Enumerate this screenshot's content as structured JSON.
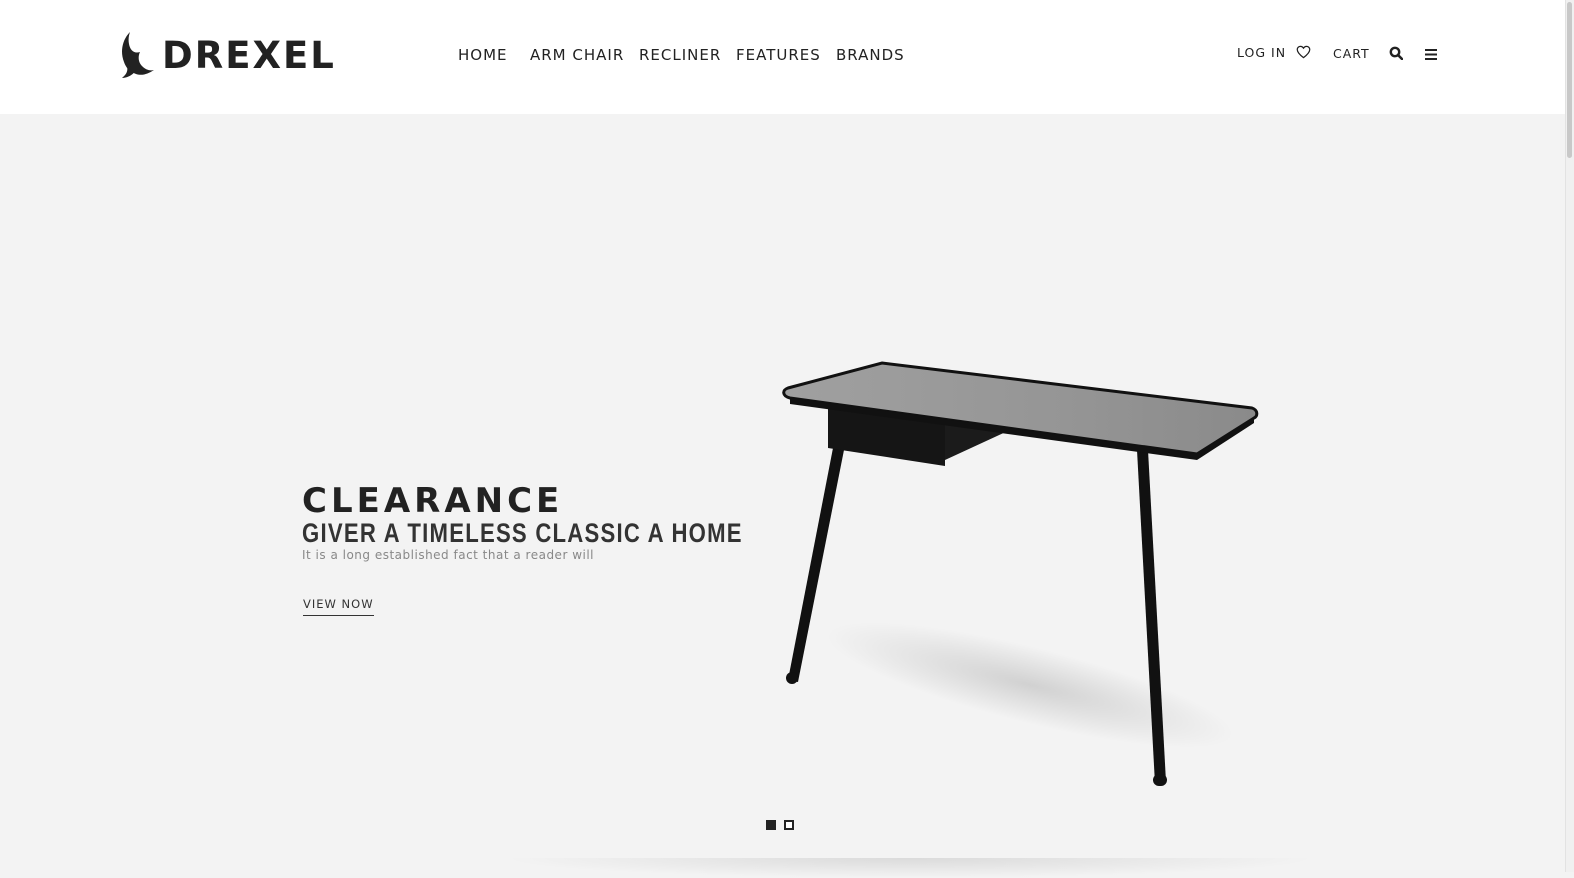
{
  "brand": {
    "name": "DREXEL",
    "logo_icon": "bird-logo-icon"
  },
  "nav": {
    "items": [
      {
        "label": "HOME"
      },
      {
        "label": "ARM CHAIR"
      },
      {
        "label": "RECLINER"
      },
      {
        "label": "FEATURES"
      },
      {
        "label": "BRANDS"
      }
    ]
  },
  "header_utils": {
    "login_label": "LOG IN",
    "wishlist_icon": "heart-icon",
    "cart_label": "CART",
    "search_icon": "search-icon",
    "menu_icon": "menu-icon"
  },
  "hero": {
    "title": "CLEARANCE",
    "subtitle": "GIVER A TIMELESS CLASSIC A HOME",
    "description": "It is a long established fact that a reader will",
    "cta_label": "VIEW NOW",
    "image": "desk-product-image"
  },
  "slider": {
    "total_slides": 2,
    "active_slide": 1
  },
  "colors": {
    "header_bg": "#ffffff",
    "hero_bg": "#f3f3f3",
    "text": "#222222"
  }
}
